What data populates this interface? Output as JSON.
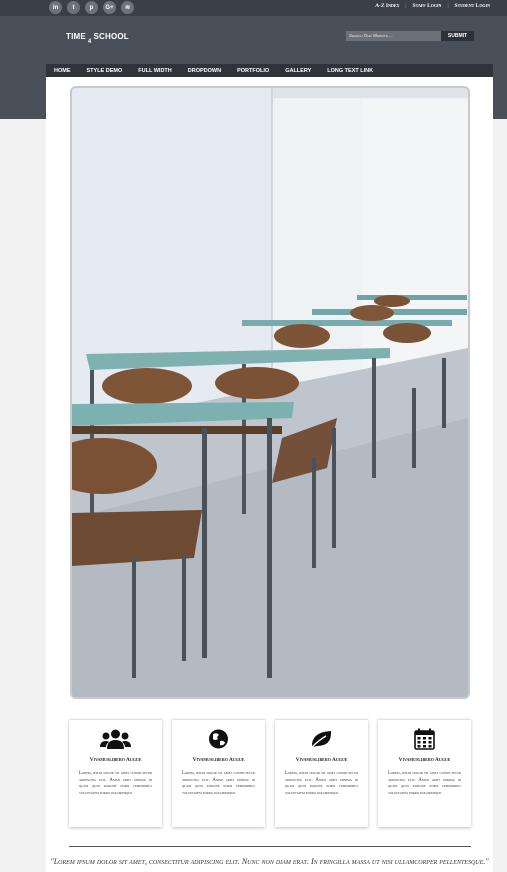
{
  "social": {
    "items": [
      {
        "icon": "linkedin-icon",
        "glyph": "in"
      },
      {
        "icon": "twitter-icon",
        "glyph": "t"
      },
      {
        "icon": "pinterest-icon",
        "glyph": "p"
      },
      {
        "icon": "google-plus-icon",
        "glyph": "G+"
      },
      {
        "icon": "wifi-icon",
        "glyph": "≋"
      }
    ]
  },
  "toplinks": {
    "az_index": "A-Z Index",
    "staff_login": "Staff Login",
    "student_login": "Student Login"
  },
  "header": {
    "logo_left": "TIME",
    "logo_sub": "4",
    "logo_right": "SCHOOL",
    "search_placeholder": "Search Our Website ...",
    "submit_label": "SUBMIT"
  },
  "nav": {
    "items": [
      "HOME",
      "STYLE DEMO",
      "FULL WIDTH",
      "DROPDOWN",
      "PORTFOLIO",
      "GALLERY",
      "LONG TEXT LINK"
    ]
  },
  "features": [
    {
      "icon": "users-icon",
      "title": "Vivamuslibero Augue",
      "text": "Lorem, ipsum dolor sit amet consectetur adipiscing elit. Animi amet minima id quam quos ratione noris temporibus voluptatem porro doloremque."
    },
    {
      "icon": "globe-icon",
      "title": "Vivamuslibero Augue",
      "text": "Lorem, ipsum dolor sit amet consectetur adipiscing elit. Animi amet minima id quam quos ratione noris temporibus voluptatem porro doloremque."
    },
    {
      "icon": "leaf-icon",
      "title": "Vivamuslibero Augue",
      "text": "Lorem, ipsum dolor sit amet consectetur adipiscing elit. Animi amet minima id quam quos ratione noris temporibus voluptatem porro doloremque."
    },
    {
      "icon": "calendar-icon",
      "title": "Vivamuslibero Augue",
      "text": "Lorem, ipsum dolor sit amet consectetur adipiscing elit. Animi amet minima id quam quos ratione noris temporibus voluptatem porro doloremque."
    }
  ],
  "quote": {
    "text": "\"Lorem ipsum dolor sit amet, consectitur adipiscing elit. Nunc non diam erat. In fringilla massa ut nisi ullamcorper pellentesque.\""
  }
}
